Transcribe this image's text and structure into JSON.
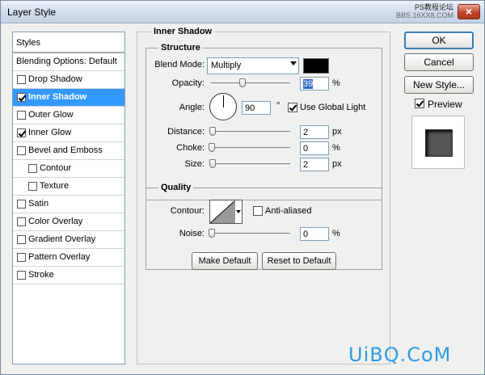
{
  "window": {
    "title": "Layer Style",
    "close_symbol": "×",
    "watermark_top_a": "PS教程论坛",
    "watermark_top_b": "BBS.16XX8.COM"
  },
  "styles_list": {
    "header": "Styles",
    "items": [
      {
        "label": "Blending Options: Default",
        "has_checkbox": false,
        "checked": false,
        "selected": false
      },
      {
        "label": "Drop Shadow",
        "has_checkbox": true,
        "checked": false,
        "selected": false
      },
      {
        "label": "Inner Shadow",
        "has_checkbox": true,
        "checked": true,
        "selected": true
      },
      {
        "label": "Outer Glow",
        "has_checkbox": true,
        "checked": false,
        "selected": false
      },
      {
        "label": "Inner Glow",
        "has_checkbox": true,
        "checked": true,
        "selected": false
      },
      {
        "label": "Bevel and Emboss",
        "has_checkbox": true,
        "checked": false,
        "selected": false
      },
      {
        "label": "Contour",
        "has_checkbox": true,
        "checked": false,
        "selected": false
      },
      {
        "label": "Texture",
        "has_checkbox": true,
        "checked": false,
        "selected": false
      },
      {
        "label": "Satin",
        "has_checkbox": true,
        "checked": false,
        "selected": false
      },
      {
        "label": "Color Overlay",
        "has_checkbox": true,
        "checked": false,
        "selected": false
      },
      {
        "label": "Gradient Overlay",
        "has_checkbox": true,
        "checked": false,
        "selected": false
      },
      {
        "label": "Pattern Overlay",
        "has_checkbox": true,
        "checked": false,
        "selected": false
      },
      {
        "label": "Stroke",
        "has_checkbox": true,
        "checked": false,
        "selected": false
      }
    ]
  },
  "inner_shadow": {
    "title": "Inner Shadow",
    "structure": {
      "title": "Structure",
      "blend_mode_label": "Blend Mode:",
      "blend_mode_value": "Multiply",
      "shadow_color": "#000000",
      "opacity_label": "Opacity:",
      "opacity_value": "39",
      "opacity_unit": "%",
      "angle_label": "Angle:",
      "angle_value": "90",
      "angle_unit": "°",
      "use_global_light_label": "Use Global Light",
      "use_global_light_checked": true,
      "distance_label": "Distance:",
      "distance_value": "2",
      "distance_unit": "px",
      "choke_label": "Choke:",
      "choke_value": "0",
      "choke_unit": "%",
      "size_label": "Size:",
      "size_value": "2",
      "size_unit": "px"
    },
    "quality": {
      "title": "Quality",
      "contour_label": "Contour:",
      "anti_aliased_label": "Anti-aliased",
      "anti_aliased_checked": false,
      "noise_label": "Noise:",
      "noise_value": "0",
      "noise_unit": "%"
    },
    "make_default_label": "Make Default",
    "reset_default_label": "Reset to Default"
  },
  "side_buttons": {
    "ok_label": "OK",
    "cancel_label": "Cancel",
    "new_style_label": "New Style...",
    "preview_label": "Preview",
    "preview_checked": true
  },
  "watermark_bottom": "UiBQ.CoM"
}
